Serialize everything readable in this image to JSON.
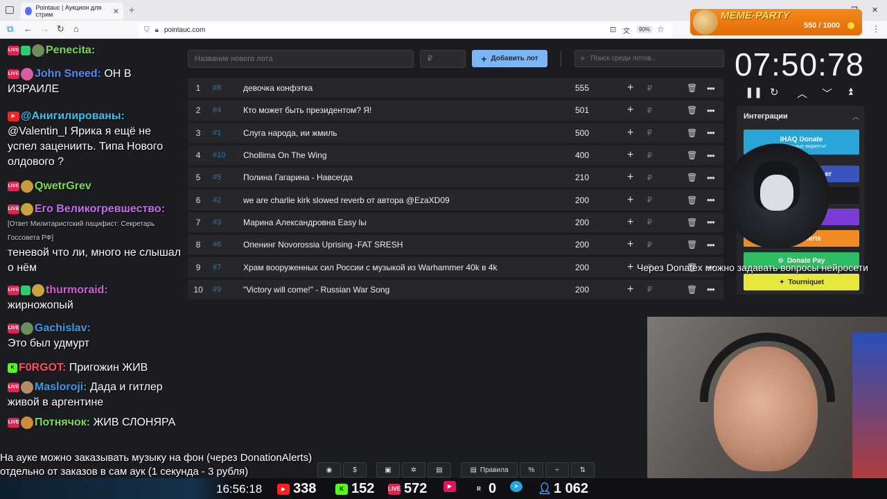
{
  "browser": {
    "tab_title": "Pointauc | Аукцион для стрим",
    "url": "pointauc.com",
    "zoom": "90%"
  },
  "banner": {
    "title": "MEME-PARTY",
    "count": "550 / 1000"
  },
  "chat": [
    {
      "user": "Penecita:",
      "text": "",
      "color": "#7ed957"
    },
    {
      "user": "John Sneed:",
      "text": "ОН В ИЗРАИЛЕ",
      "color": "#4f8ef7"
    },
    {
      "user": "@Анигилированы:",
      "text": "@Valentin_I Ярика я ещё не успел зацениить. Типа Нового олдового ?",
      "color": "#3ec1f3"
    },
    {
      "user": "QwetrGrev",
      "text": "",
      "color": "#7ed957"
    },
    {
      "user": "Его Великогревшество:",
      "text": "",
      "color": "#c86cf0"
    },
    {
      "quote": "[Ответ Милитаристский пацифист: Секретарь Госсовета РФ]",
      "text": "теневой что ли, много не слышал о нём"
    },
    {
      "user": "thurmoraid:",
      "text": "жирножопый",
      "color": "#d45fd4"
    },
    {
      "user": "Gachislav:",
      "text": "Это был удмурт",
      "color": "#3d9be9"
    },
    {
      "user": "F0RGOT:",
      "text": "Пригожин ЖИВ",
      "color": "#ff4f5e"
    },
    {
      "user": "Masloroji:",
      "text": "Дада и гитлер живой в аргентине",
      "color": "#3d9be9"
    },
    {
      "user": "Потнячок:",
      "text": "ЖИВ СЛОНЯРА",
      "color": "#7ed957"
    }
  ],
  "controls": {
    "lot_name_placeholder": "Название нового лота",
    "price_placeholder": "₽",
    "add_lot": "Добавить лот",
    "search_placeholder": "Поиск среди лотов..."
  },
  "lots": [
    {
      "idx": "1",
      "hash": "#8",
      "name": "девочка конфэтка",
      "amount": "555"
    },
    {
      "idx": "2",
      "hash": "#4",
      "name": "Кто может быть президентом? Я!",
      "amount": "501"
    },
    {
      "idx": "3",
      "hash": "#1",
      "name": "Слуга народа, ии жмиль",
      "amount": "500"
    },
    {
      "idx": "4",
      "hash": "#10",
      "name": "Chollima On The Wing",
      "amount": "400"
    },
    {
      "idx": "5",
      "hash": "#5",
      "name": "Полина Гагарина - Навсегда",
      "amount": "210"
    },
    {
      "idx": "6",
      "hash": "#2",
      "name": "we are charlie kirk slowed reverb от автора @EzaXD09",
      "amount": "200"
    },
    {
      "idx": "7",
      "hash": "#3",
      "name": "Марина Александровна Easy lы",
      "amount": "200"
    },
    {
      "idx": "8",
      "hash": "#6",
      "name": "Опенинг Novorossia Uprising -FAT SRESH",
      "amount": "200"
    },
    {
      "idx": "9",
      "hash": "#7",
      "name": "Храм вооруженных сил России с музыкой из Warhammer 40k в 4k",
      "amount": "200"
    },
    {
      "idx": "10",
      "hash": "#9",
      "name": "\"Victory will come!\" - Russian War Song",
      "amount": "200"
    }
  ],
  "timer": "07:50:78",
  "integrations": {
    "title": "Интеграции",
    "ihaq": "IHAQ Donate",
    "ihaq_sub": "Уникальные виджеты!",
    "buttons": [
      {
        "label": "er",
        "color": "#3a54c0"
      },
      {
        "label": "",
        "color": "#1a1a1d"
      },
      {
        "label": "",
        "color": "#7b3bd6"
      },
      {
        "label": "Alerts",
        "color": "#f08a24"
      },
      {
        "label": "Donate Pay",
        "color": "#2ebd62"
      },
      {
        "label": "Tourniquet",
        "color": "#e5e83d"
      }
    ]
  },
  "overlay_tip": "Через Donatex можно задавать вопросы нейросети",
  "bottom_msg": {
    "line1": "На ауке можно заказывать музыку на фон (через DonationAlerts)",
    "line2": "отдельно от заказов в сам аук (1 секунда - 3 рубля)"
  },
  "toolbar": {
    "rules": "Правила"
  },
  "stats": {
    "clock": "16:56:18",
    "youtube": "338",
    "kick": "152",
    "live": "572",
    "vk": "0",
    "rutube": "0",
    "viewers": "1 062"
  }
}
